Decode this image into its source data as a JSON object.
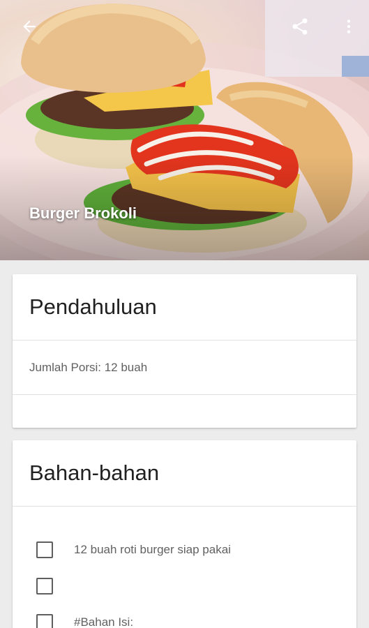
{
  "hero": {
    "title": "Burger Brokoli",
    "back_icon": "arrow-back-icon",
    "share_icon": "share-icon",
    "more_icon": "more-vert-icon"
  },
  "intro_card": {
    "title": "Pendahuluan",
    "portion": "Jumlah Porsi: 12 buah",
    "extra": ""
  },
  "ingredients_card": {
    "title": "Bahan-bahan",
    "items": [
      {
        "label": "12 buah roti burger siap pakai",
        "checked": false
      },
      {
        "label": "",
        "checked": false
      },
      {
        "label": "#Bahan Isi:",
        "checked": false
      }
    ]
  },
  "colors": {
    "background": "#ececec",
    "card": "#ffffff",
    "title_text": "#212121",
    "body_text": "#616161"
  }
}
